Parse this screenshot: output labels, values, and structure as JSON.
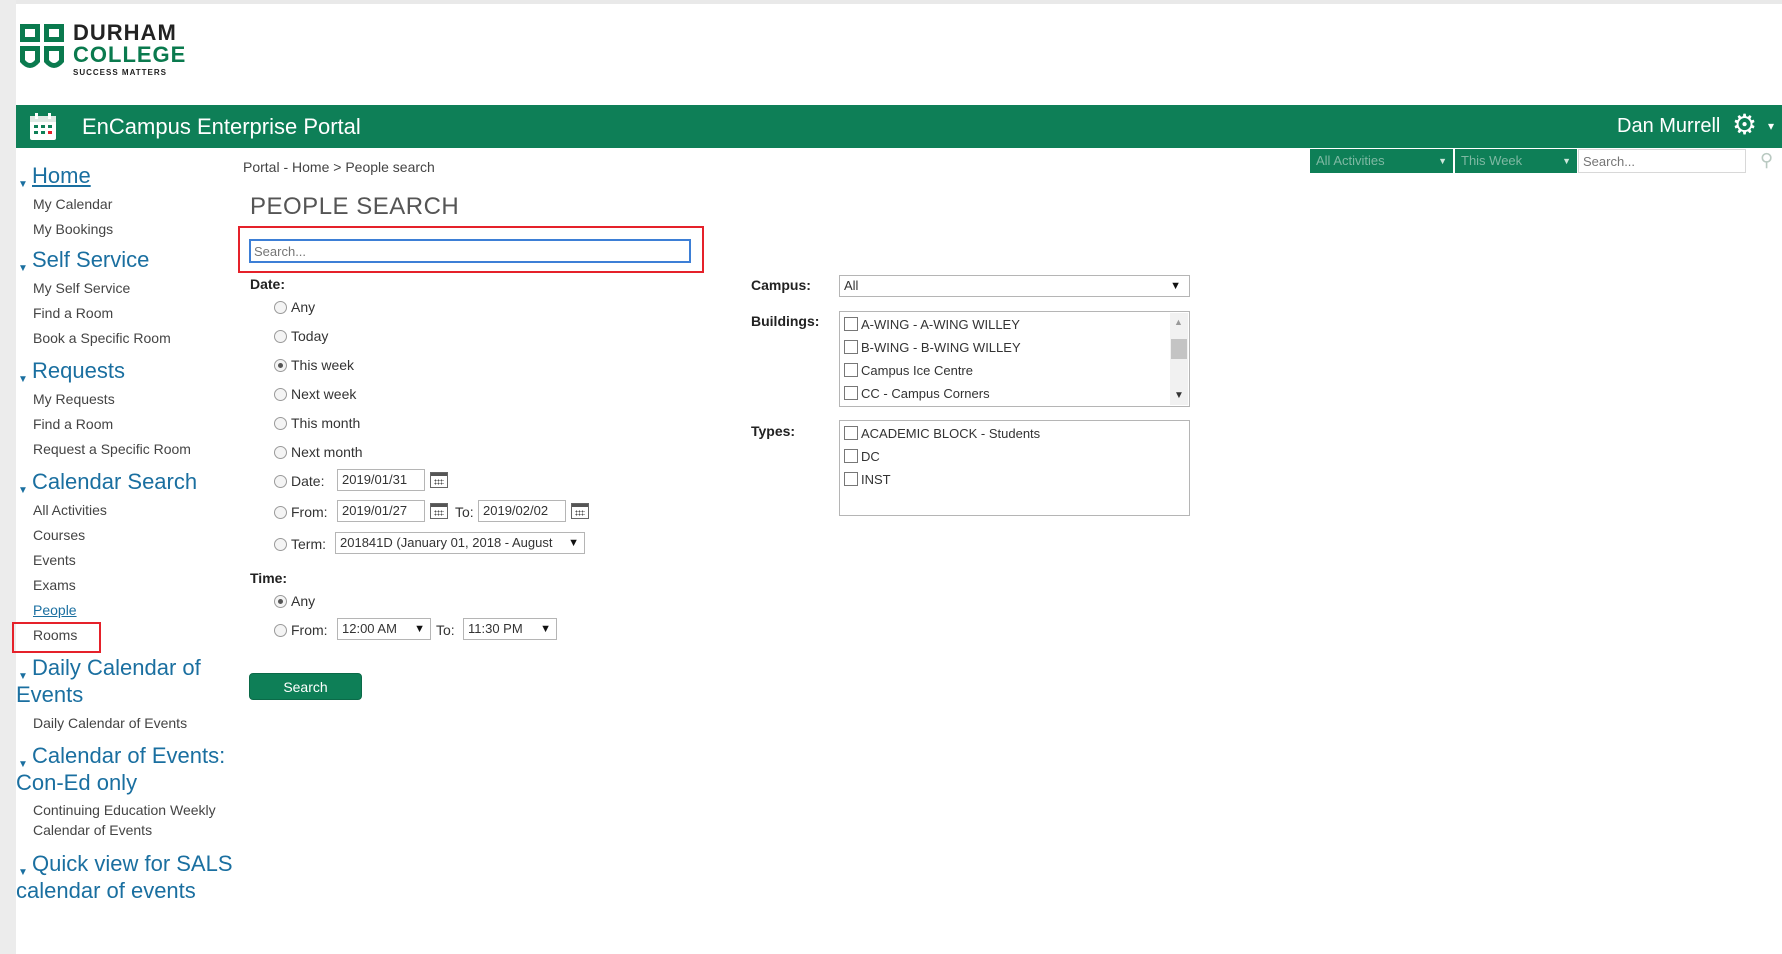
{
  "logo": {
    "line1": "DURHAM",
    "line2": "COLLEGE",
    "line3": "SUCCESS MATTERS"
  },
  "header": {
    "title": "EnCampus Enterprise Portal",
    "user": "Dan Murrell",
    "filter1": "All Activities",
    "filter2": "This Week",
    "search_placeholder": "Search..."
  },
  "sidebar": {
    "sections": [
      {
        "title": "Home",
        "items": [
          "My Calendar",
          "My Bookings"
        ]
      },
      {
        "title": "Self Service",
        "items": [
          "My Self Service",
          "Find a Room",
          "Book a Specific Room"
        ]
      },
      {
        "title": "Requests",
        "items": [
          "My Requests",
          "Find a Room",
          "Request a Specific Room"
        ]
      },
      {
        "title": "Calendar Search",
        "items": [
          "All Activities",
          "Courses",
          "Events",
          "Exams",
          "People",
          "Rooms"
        ]
      },
      {
        "title_line1": "Daily Calendar of",
        "title_line2": "Events",
        "items": [
          "Daily Calendar of Events"
        ]
      },
      {
        "title_line1": "Calendar of Events:",
        "title_line2": "Con-Ed only",
        "item_line1": "Continuing Education Weekly",
        "item_line2": "Calendar of Events"
      },
      {
        "title_line1": "Quick view for SALS",
        "title_line2": "calendar of events"
      }
    ]
  },
  "breadcrumb": "Portal - Home > People search",
  "page_title": "PEOPLE SEARCH",
  "search": {
    "placeholder": "Search..."
  },
  "date": {
    "label": "Date:",
    "options": [
      "Any",
      "Today",
      "This week",
      "Next week",
      "This month",
      "Next month"
    ],
    "selected": "This week",
    "date_label": "Date:",
    "date_value": "2019/01/31",
    "from_label": "From:",
    "from_value": "2019/01/27",
    "to_label": "To:",
    "to_value": "2019/02/02",
    "term_label": "Term:",
    "term_value": "201841D (January 01, 2018 - August"
  },
  "time": {
    "label": "Time:",
    "any": "Any",
    "from_label": "From:",
    "from_value": "12:00 AM",
    "to_label": "To:",
    "to_value": "11:30 PM"
  },
  "search_button": "Search",
  "campus": {
    "label": "Campus:",
    "value": "All"
  },
  "buildings": {
    "label": "Buildings:",
    "items": [
      "A-WING - A-WING WILLEY",
      "B-WING - B-WING WILLEY",
      "Campus Ice Centre",
      "CC - Campus Corners"
    ]
  },
  "types": {
    "label": "Types:",
    "items": [
      "ACADEMIC BLOCK - Students",
      "DC",
      "INST"
    ]
  },
  "colors": {
    "brand_green": "#0e7f57",
    "link_blue": "#1a6fa0",
    "highlight_red": "#e5212a"
  }
}
